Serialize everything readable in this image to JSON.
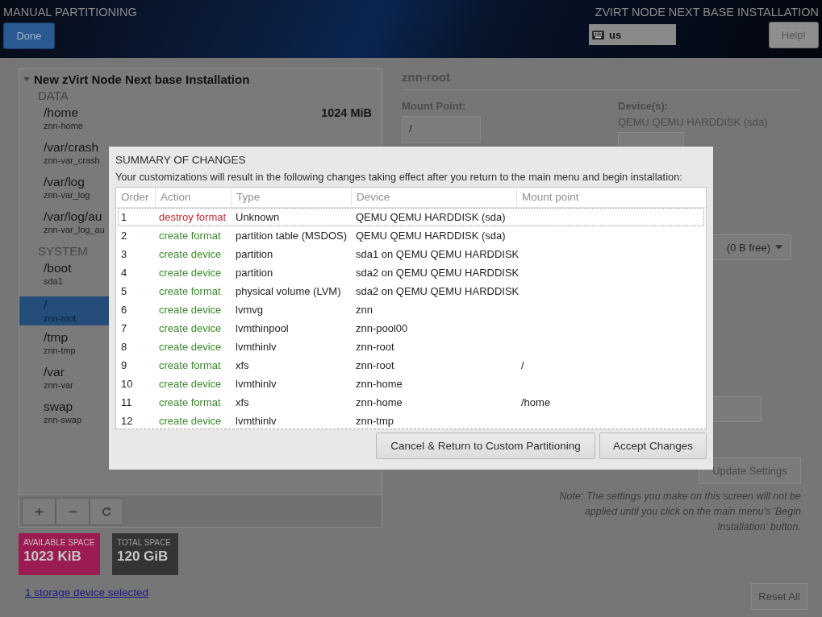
{
  "header": {
    "title": "MANUAL PARTITIONING",
    "done_button": "Done",
    "product": "ZVIRT NODE NEXT BASE INSTALLATION",
    "keyboard_layout": "us",
    "help_button": "Help!"
  },
  "partitions": {
    "title": "New zVirt Node Next base Installation",
    "expanded": true,
    "sections": [
      {
        "name": "DATA",
        "items": [
          {
            "mount": "/home",
            "device": "znn-home",
            "size": "1024 MiB",
            "selected": false
          },
          {
            "mount": "/var/crash",
            "device": "znn-var_crash",
            "selected": false
          },
          {
            "mount": "/var/log",
            "device": "znn-var_log",
            "selected": false
          },
          {
            "mount": "/var/log/au",
            "device": "znn-var_log_au",
            "selected": false
          }
        ]
      },
      {
        "name": "SYSTEM",
        "items": [
          {
            "mount": "/boot",
            "device": "sda1",
            "selected": false
          },
          {
            "mount": "/",
            "device": "znn-root",
            "selected": true
          },
          {
            "mount": "/tmp",
            "device": "znn-tmp",
            "selected": false
          },
          {
            "mount": "/var",
            "device": "znn-var",
            "selected": false
          },
          {
            "mount": "swap",
            "device": "znn-swap",
            "selected": false
          }
        ]
      }
    ]
  },
  "space": {
    "available_label": "AVAILABLE SPACE",
    "available": "1023 KiB",
    "total_label": "TOTAL SPACE",
    "total": "120 GiB"
  },
  "storage_link": "1 storage device selected",
  "details": {
    "name": "znn-root",
    "mount_point_label": "Mount Point:",
    "mount_point": "/",
    "devices_label": "Device(s):",
    "devices": "QEMU QEMU HARDDISK (sda)",
    "volume_group": "(0 B free)",
    "update_button": "Update Settings",
    "note": "Note:  The settings you make on this screen will not be applied until you click on the main menu's 'Begin Installation' button.",
    "reset_button": "Reset All"
  },
  "dialog": {
    "title": "SUMMARY OF CHANGES",
    "message": "Your customizations will result in the following changes taking effect after you return to the main menu and begin installation:",
    "columns": [
      "Order",
      "Action",
      "Type",
      "Device",
      "Mount point"
    ],
    "rows": [
      {
        "order": "1",
        "action": "destroy format",
        "kind": "destroy",
        "type": "Unknown",
        "device": "QEMU QEMU HARDDISK (sda)",
        "selected": true
      },
      {
        "order": "2",
        "action": "create format",
        "kind": "create",
        "type": "partition table (MSDOS)",
        "device": "QEMU QEMU HARDDISK (sda)",
        "selected": false
      },
      {
        "order": "3",
        "action": "create device",
        "kind": "create",
        "type": "partition",
        "device": "sda1 on QEMU QEMU HARDDISK",
        "selected": false
      },
      {
        "order": "4",
        "action": "create device",
        "kind": "create",
        "type": "partition",
        "device": "sda2 on QEMU QEMU HARDDISK",
        "selected": false
      },
      {
        "order": "5",
        "action": "create format",
        "kind": "create",
        "type": "physical volume (LVM)",
        "device": "sda2 on QEMU QEMU HARDDISK",
        "selected": false
      },
      {
        "order": "6",
        "action": "create device",
        "kind": "create",
        "type": "lvmvg",
        "device": "znn",
        "selected": false
      },
      {
        "order": "7",
        "action": "create device",
        "kind": "create",
        "type": "lvmthinpool",
        "device": "znn-pool00",
        "selected": false
      },
      {
        "order": "8",
        "action": "create device",
        "kind": "create",
        "type": "lvmthinlv",
        "device": "znn-root",
        "selected": false
      },
      {
        "order": "9",
        "action": "create format",
        "kind": "create",
        "type": "xfs",
        "device": "znn-root",
        "mount": "/",
        "selected": false
      },
      {
        "order": "10",
        "action": "create device",
        "kind": "create",
        "type": "lvmthinlv",
        "device": "znn-home",
        "selected": false
      },
      {
        "order": "11",
        "action": "create format",
        "kind": "create",
        "type": "xfs",
        "device": "znn-home",
        "mount": "/home",
        "selected": false
      },
      {
        "order": "12",
        "action": "create device",
        "kind": "create",
        "type": "lvmthinlv",
        "device": "znn-tmp",
        "selected": false
      }
    ],
    "cancel_button": "Cancel & Return to Custom Partitioning",
    "accept_button": "Accept Changes"
  }
}
